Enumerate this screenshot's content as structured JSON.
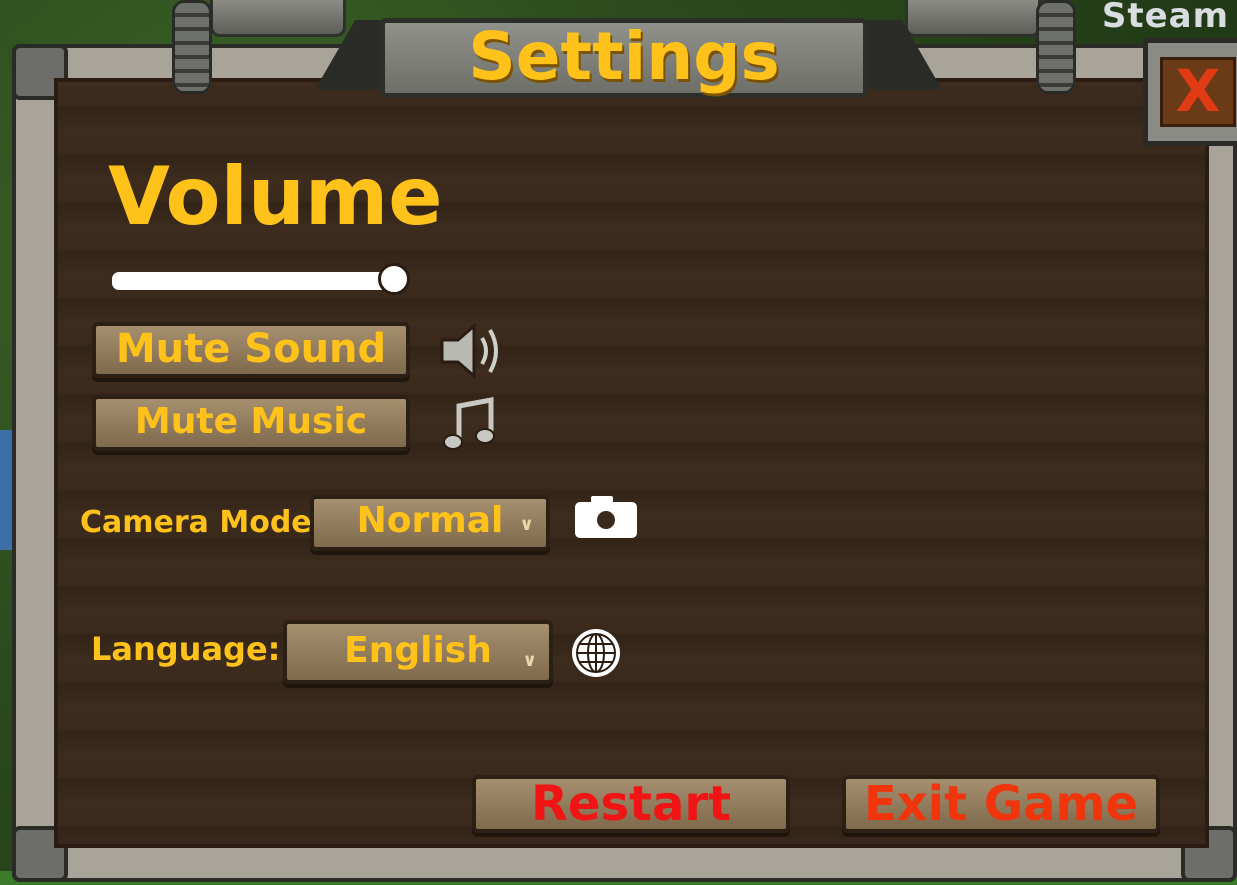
{
  "corner": {
    "steam_label": "Steam"
  },
  "dialog": {
    "title": "Settings",
    "close_label": "X"
  },
  "volume": {
    "label": "Volume",
    "level_percent": 100
  },
  "buttons": {
    "mute_sound": "Mute Sound",
    "mute_music": "Mute Music",
    "restart": "Restart",
    "exit_game": "Exit Game"
  },
  "camera": {
    "label": "Camera Mode:",
    "selected": "Normal"
  },
  "language": {
    "label": "Language:",
    "selected": "English"
  },
  "icons": {
    "speaker": "speaker-icon",
    "music": "music-note-icon",
    "camera": "camera-icon",
    "globe": "globe-icon",
    "chevron": "chevron-down-icon"
  },
  "colors": {
    "label_yellow": "#ffc21a",
    "danger_red": "#f01414",
    "wood_dark": "#3e2c1e"
  }
}
